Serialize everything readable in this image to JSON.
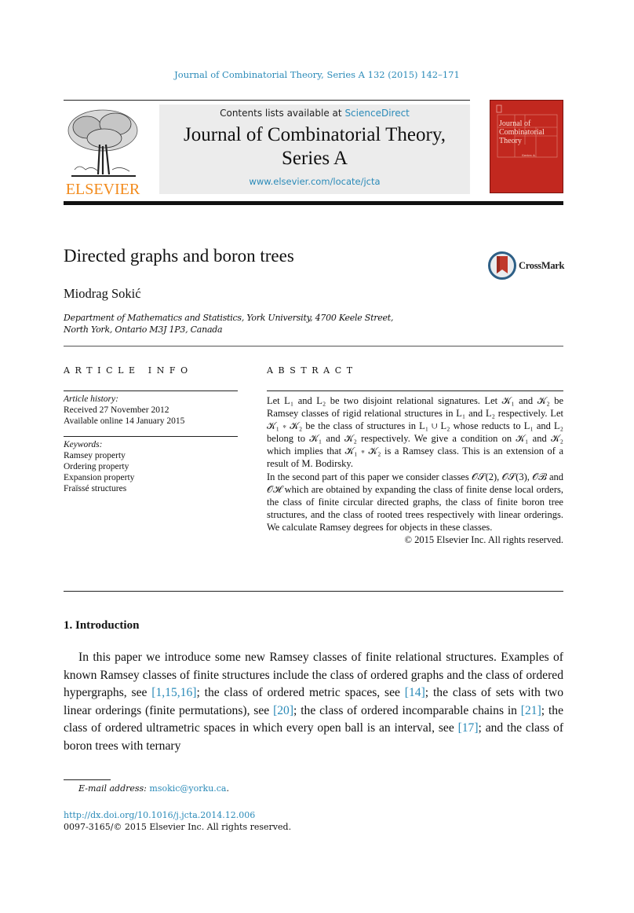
{
  "header": {
    "running_head": "Journal of Combinatorial Theory, Series A 132 (2015) 142–171",
    "publisher_logo_text": "ELSEVIER",
    "contents_prefix": "Contents lists available at ",
    "contents_link": "ScienceDirect",
    "journal_title_line1": "Journal of Combinatorial Theory,",
    "journal_title_line2": "Series A",
    "journal_url": "www.elsevier.com/locate/jcta",
    "cover_title_lines": [
      "Journal of",
      "Combinatorial",
      "Theory"
    ],
    "cover_series": "Series A"
  },
  "article": {
    "title": "Directed graphs and boron trees",
    "crossmark_label": "CrossMark",
    "author": "Miodrag Sokić",
    "affiliation_line1": "Department of Mathematics and Statistics, York University, 4700 Keele Street,",
    "affiliation_line2": "North York, Ontario M3J 1P3, Canada"
  },
  "article_info": {
    "heading": "ARTICLE INFO",
    "history_label": "Article history:",
    "received": "Received 27 November 2012",
    "available_online": "Available online 14 January 2015",
    "keywords_label": "Keywords:",
    "keywords": [
      "Ramsey property",
      "Ordering property",
      "Expansion property",
      "Fraïssé structures"
    ]
  },
  "abstract": {
    "heading": "ABSTRACT",
    "paragraph1": "Let L₁ and L₂ be two disjoint relational signatures. Let 𝒦₁ and 𝒦₂ be Ramsey classes of rigid relational structures in L₁ and L₂ respectively. Let 𝒦₁ ∗ 𝒦₂ be the class of structures in L₁ ∪ L₂ whose reducts to L₁ and L₂ belong to 𝒦₁ and 𝒦₂ respectively. We give a condition on 𝒦₁ and 𝒦₂ which implies that 𝒦₁ ∗ 𝒦₂ is a Ramsey class. This is an extension of a result of M. Bodirsky.",
    "paragraph2": "In the second part of this paper we consider classes 𝒪𝒮(2), 𝒪𝒮(3), 𝒪ℬ and 𝒪ℋ which are obtained by expanding the class of finite dense local orders, the class of finite circular directed graphs, the class of finite boron tree structures, and the class of rooted trees respectively with linear orderings. We calculate Ramsey degrees for objects in these classes.",
    "copyright": "© 2015 Elsevier Inc. All rights reserved."
  },
  "body": {
    "section_heading": "1.  Introduction",
    "intro_segments": [
      {
        "text": "In this paper we introduce some new Ramsey classes of finite relational structures. Examples of known Ramsey classes of finite structures include the class of ordered graphs and the class of ordered hypergraphs, see ",
        "link": false
      },
      {
        "text": "[1,15,16]",
        "link": true
      },
      {
        "text": "; the class of ordered metric spaces, see ",
        "link": false
      },
      {
        "text": "[14]",
        "link": true
      },
      {
        "text": "; the class of sets with two linear orderings (finite permutations), see ",
        "link": false
      },
      {
        "text": "[20]",
        "link": true
      },
      {
        "text": "; the class of ordered incomparable chains in ",
        "link": false
      },
      {
        "text": "[21]",
        "link": true
      },
      {
        "text": "; the class of ordered ultrametric spaces in which every open ball is an interval, see ",
        "link": false
      },
      {
        "text": "[17]",
        "link": true
      },
      {
        "text": "; and the class of boron trees with ternary",
        "link": false
      }
    ]
  },
  "footer": {
    "email_label": "E-mail address:",
    "email": "msokic@yorku.ca",
    "email_suffix": ".",
    "doi_link": "http://dx.doi.org/10.1016/j.jcta.2014.12.006",
    "issn_line": "0097-3165/© 2015 Elsevier Inc. All rights reserved."
  },
  "colors": {
    "link": "#2a8ab8",
    "elsevier_orange": "#f28a1b",
    "cover_red": "#c2281f",
    "journal_box_bg": "#ececec"
  }
}
